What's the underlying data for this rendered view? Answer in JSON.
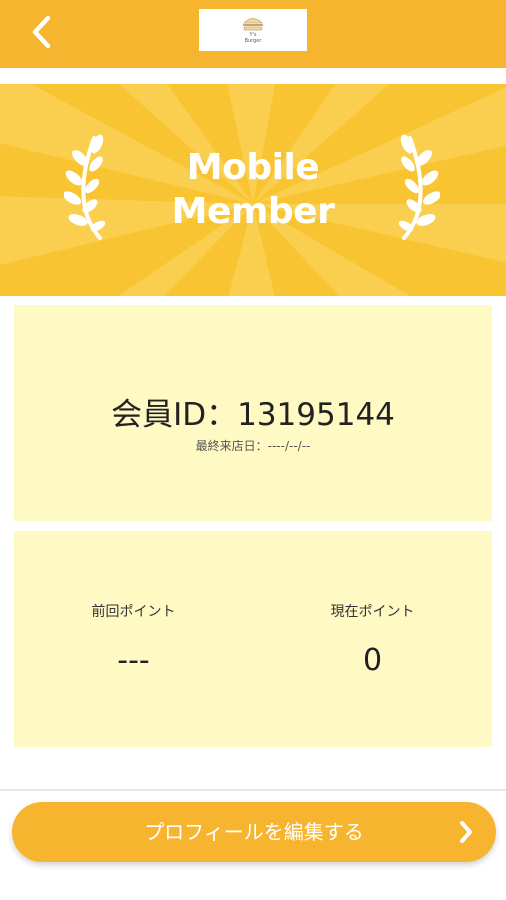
{
  "header": {
    "back_icon": "chevron-left-icon",
    "logo": {
      "line1": "Y's",
      "line2": "Burger"
    }
  },
  "hero": {
    "title_line1": "Mobile",
    "title_line2": "Member",
    "background_color": "#f9c431"
  },
  "member_card": {
    "member_id": "会員ID：13195144",
    "last_visit": "最終来店日：----/--/--"
  },
  "points_card": {
    "previous": {
      "label": "前回ポイント",
      "value": "---"
    },
    "current": {
      "label": "現在ポイント",
      "value": "0"
    }
  },
  "edit_profile_button": {
    "label": "プロフィールを編集する",
    "icon": "chevron-right-icon"
  },
  "colors": {
    "accent": "#f5b52e",
    "card_background": "#fff9c4"
  }
}
